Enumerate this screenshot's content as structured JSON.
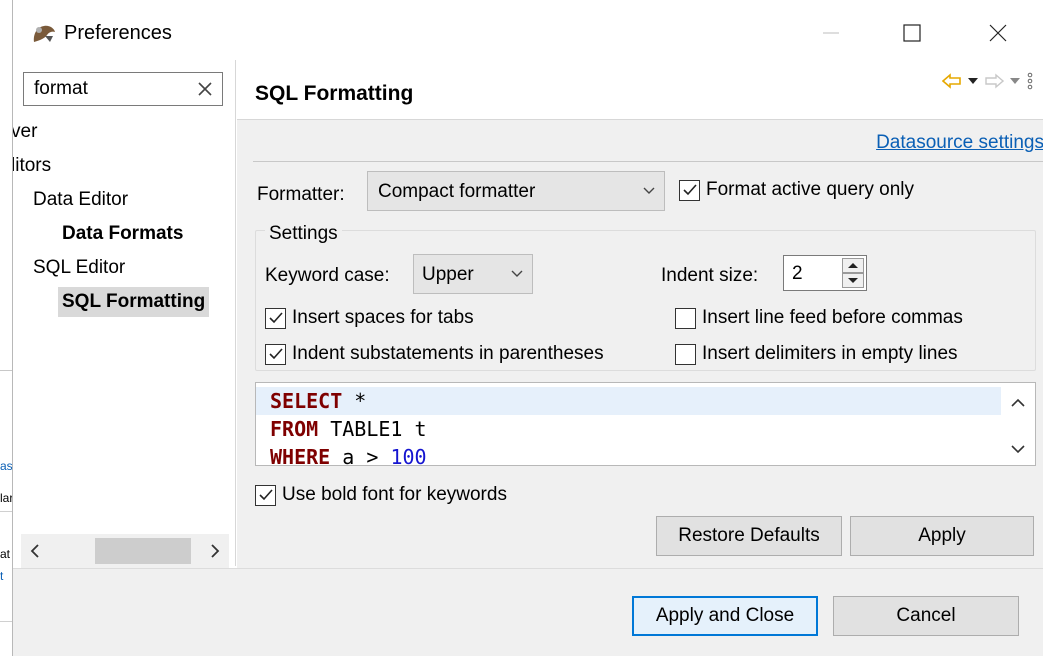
{
  "window": {
    "title": "Preferences",
    "controls": {
      "minimize": "minimize-icon",
      "maximize": "maximize-icon",
      "close": "close-icon"
    }
  },
  "filter": {
    "value": "format"
  },
  "tree": {
    "items": [
      {
        "label": "ver",
        "bold": false
      },
      {
        "label": "litors",
        "bold": false
      },
      {
        "label": "Data Editor",
        "bold": false
      },
      {
        "label": "Data Formats",
        "bold": true
      },
      {
        "label": "SQL Editor",
        "bold": false
      },
      {
        "label": "SQL Formatting",
        "bold": true,
        "selected": true
      }
    ]
  },
  "background_window": {
    "fragments": [
      "as",
      "lar",
      "at",
      "t"
    ]
  },
  "page": {
    "title": "SQL Formatting",
    "datasource_link": "Datasource settings",
    "formatter_label": "Formatter:",
    "formatter_value": "Compact formatter",
    "format_active_only": {
      "label": "Format active query only",
      "checked": true
    },
    "settings_legend": "Settings",
    "keyword_case_label": "Keyword case:",
    "keyword_case_value": "Upper",
    "indent_size_label": "Indent size:",
    "indent_size_value": "2",
    "options": {
      "insert_spaces": {
        "label": "Insert spaces for tabs",
        "checked": true
      },
      "indent_substatements": {
        "label": "Indent substatements in parentheses",
        "checked": true
      },
      "line_feed_commas": {
        "label": "Insert line feed before commas",
        "checked": false
      },
      "delimiters_empty": {
        "label": "Insert delimiters in empty lines",
        "checked": false
      }
    },
    "preview": {
      "line1_kw": "SELECT",
      "line1_rest": " *",
      "line2_kw": "FROM",
      "line2_rest": " TABLE1 t",
      "line3_kw": "WHERE",
      "line3_rest": " a > ",
      "line3_num": "100"
    },
    "bold_keywords": {
      "label": "Use bold font for keywords",
      "checked": true
    },
    "restore_defaults": "Restore Defaults",
    "apply": "Apply"
  },
  "footer": {
    "apply_close": "Apply and Close",
    "cancel": "Cancel"
  },
  "colors": {
    "accent": "#0078d7",
    "link": "#0a5fb5",
    "keyword": "#7f0000",
    "number": "#1515d0",
    "nav_arrow": "#e6a800"
  }
}
